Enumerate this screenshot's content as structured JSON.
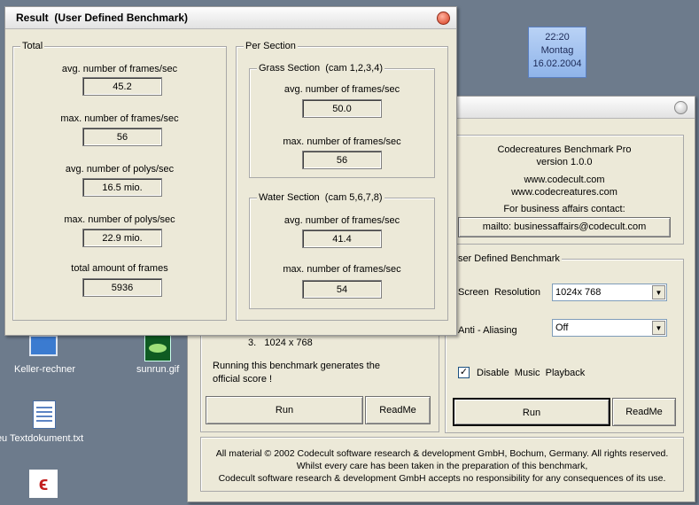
{
  "clock": {
    "time": "22:20",
    "day": "Montag",
    "date": "16.02.2004"
  },
  "desktop": {
    "icons": [
      {
        "label": "Keller-rechner"
      },
      {
        "label": "sunrun.gif"
      },
      {
        "label": "Neu Textdokument.txt"
      }
    ]
  },
  "back_window": {
    "info_lines": [
      "Codecreatures Benchmark Pro",
      "version 1.0.0"
    ],
    "urls": [
      "www.codecult.com",
      "www.codecreatures.com"
    ],
    "contact_label": "For business affairs contact:",
    "mailto_button": "mailto: businessaffairs@codecult.com",
    "user_group_legend": "User Defined Benchmark",
    "screen_resolution": {
      "label": "Screen  Resolution",
      "value": "1024x 768"
    },
    "anti_aliasing": {
      "label": "Anti - Aliasing",
      "value": "Off"
    },
    "disable_music": {
      "label": "Disable  Music  Playback",
      "checked": true
    },
    "left_list_item": "3.   1024 x 768",
    "left_note": "Running this benchmark generates the official score !",
    "run_label": "Run",
    "readme_label": "ReadMe",
    "footer_lines": [
      "All material © 2002 Codecult software research & development GmbH, Bochum, Germany. All rights reserved.",
      "Whilst every care has been taken in the preparation of this benchmark,",
      "Codecult software research & development GmbH accepts no responsibility for any consequences of its use."
    ]
  },
  "result_window": {
    "title": "Result  (User Defined Benchmark)",
    "total": {
      "legend": "Total",
      "stats": [
        {
          "label": "avg. number of frames/sec",
          "value": "45.2"
        },
        {
          "label": "max. number of frames/sec",
          "value": "56"
        },
        {
          "label": "avg. number of polys/sec",
          "value": "16.5 mio."
        },
        {
          "label": "max. number of polys/sec",
          "value": "22.9 mio."
        },
        {
          "label": "total amount of frames",
          "value": "5936"
        }
      ]
    },
    "per_section": {
      "legend": "Per Section",
      "grass": {
        "legend": "Grass Section  (cam 1,2,3,4)",
        "stats": [
          {
            "label": "avg. number of frames/sec",
            "value": "50.0"
          },
          {
            "label": "max. number of frames/sec",
            "value": "56"
          }
        ]
      },
      "water": {
        "legend": "Water Section  (cam 5,6,7,8)",
        "stats": [
          {
            "label": "avg. number of frames/sec",
            "value": "41.4"
          },
          {
            "label": "max. number of frames/sec",
            "value": "54"
          }
        ]
      }
    }
  }
}
